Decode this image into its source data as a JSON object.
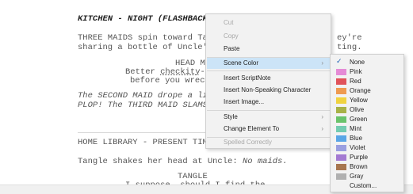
{
  "script": {
    "heading": "KITCHEN - NIGHT (FLASHBACK)",
    "action_1a": "THREE MAIDS spin toward Ta",
    "action_1b": "sharing a bottle of Uncle'",
    "action_1a_end": "ey're",
    "action_1b_end": "ting.",
    "character_1": "HEAD M",
    "dialogue_1a_pre": "Better ",
    "dialogue_1a_word": "checkity",
    "dialogue_1a_post": "-",
    "dialogue_1b": "before you wreck",
    "action_2a": "The SECOND MAID drope a li",
    "action_2b": "PLOP! The THIRD MAID SLAMS",
    "heading_2": "HOME LIBRARY - PRESENT TIME",
    "action_3_pre": "Tangle shakes her head at Uncle: ",
    "action_3_italic": "No maids.",
    "character_2": "TANGLE",
    "dialogue_2": "I suppose, should I find the"
  },
  "context_menu": {
    "items": [
      {
        "label": "Cut",
        "disabled": true
      },
      {
        "label": "Copy",
        "disabled": true
      },
      {
        "label": "Paste",
        "disabled": false
      },
      {
        "label": "Scene Color",
        "disabled": false,
        "highlighted": true,
        "submenu": true
      },
      {
        "label": "Insert ScriptNote",
        "disabled": false
      },
      {
        "label": "Insert Non-Speaking Character",
        "disabled": false
      },
      {
        "label": "Insert Image...",
        "disabled": false
      },
      {
        "label": "Style",
        "disabled": false,
        "submenu": true
      },
      {
        "label": "Change Element To",
        "disabled": false,
        "submenu": true
      },
      {
        "label": "Spelled Correctly",
        "disabled": true
      }
    ],
    "arrow_glyph": "›"
  },
  "scene_colors": {
    "check_glyph": "✓",
    "items": [
      {
        "label": "None",
        "color": "",
        "checked": true
      },
      {
        "label": "Pink",
        "color": "#e58bd6"
      },
      {
        "label": "Red",
        "color": "#e0525a"
      },
      {
        "label": "Orange",
        "color": "#ee9a50"
      },
      {
        "label": "Yellow",
        "color": "#f0d23f"
      },
      {
        "label": "Olive",
        "color": "#a8b247"
      },
      {
        "label": "Green",
        "color": "#6ac36b"
      },
      {
        "label": "Mint",
        "color": "#74ccb1"
      },
      {
        "label": "Blue",
        "color": "#5aa6e6"
      },
      {
        "label": "Violet",
        "color": "#9a9fe0"
      },
      {
        "label": "Purple",
        "color": "#a47ad2"
      },
      {
        "label": "Brown",
        "color": "#a7764f"
      },
      {
        "label": "Gray",
        "color": "#b0b0b0"
      },
      {
        "label": "Custom...",
        "color": ""
      }
    ]
  }
}
